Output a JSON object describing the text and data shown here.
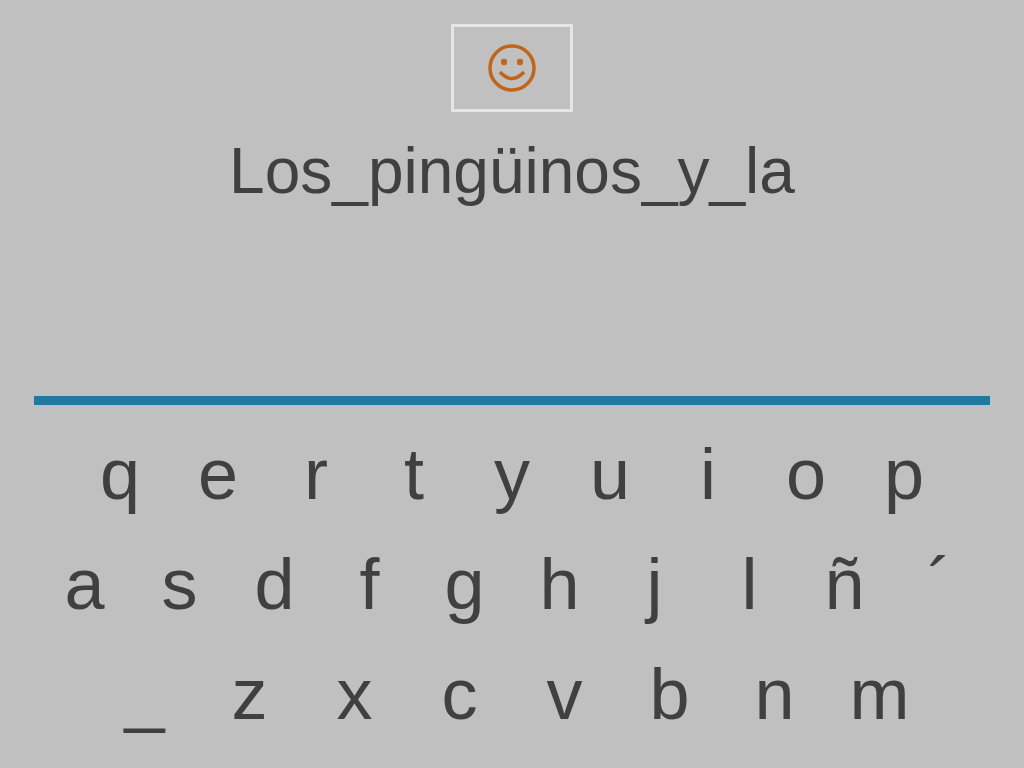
{
  "title": "Los_pingüinos_y_la",
  "keyboard": {
    "rows": [
      [
        "q",
        "e",
        "r",
        "t",
        "y",
        "u",
        "i",
        "o",
        "p"
      ],
      [
        "a",
        "s",
        "d",
        "f",
        "g",
        "h",
        "j",
        "l",
        "ñ",
        "´"
      ],
      [
        "_",
        "z",
        "x",
        "c",
        "v",
        "b",
        "n",
        "m"
      ]
    ]
  }
}
